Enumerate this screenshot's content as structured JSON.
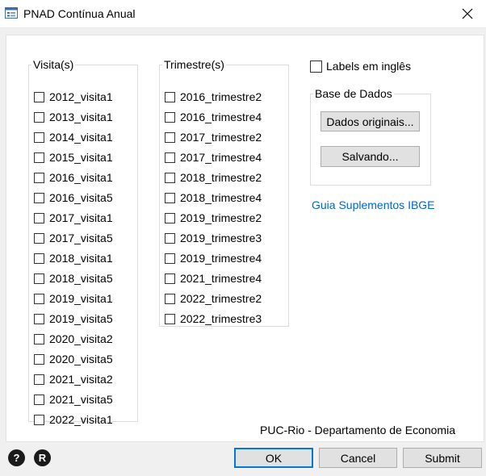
{
  "window": {
    "title": "PNAD Contínua Anual",
    "app_icon": "form-window-icon",
    "close_icon": "close-icon"
  },
  "visitas": {
    "legend": "Visita(s)",
    "items": [
      {
        "label": "2012_visita1",
        "checked": false
      },
      {
        "label": "2013_visita1",
        "checked": false
      },
      {
        "label": "2014_visita1",
        "checked": false
      },
      {
        "label": "2015_visita1",
        "checked": false
      },
      {
        "label": "2016_visita1",
        "checked": false
      },
      {
        "label": "2016_visita5",
        "checked": false
      },
      {
        "label": "2017_visita1",
        "checked": false
      },
      {
        "label": "2017_visita5",
        "checked": false
      },
      {
        "label": "2018_visita1",
        "checked": false
      },
      {
        "label": "2018_visita5",
        "checked": false
      },
      {
        "label": "2019_visita1",
        "checked": false
      },
      {
        "label": "2019_visita5",
        "checked": false
      },
      {
        "label": "2020_visita2",
        "checked": false
      },
      {
        "label": "2020_visita5",
        "checked": false
      },
      {
        "label": "2021_visita2",
        "checked": false
      },
      {
        "label": "2021_visita5",
        "checked": false
      },
      {
        "label": "2022_visita1",
        "checked": false
      }
    ]
  },
  "trimestres": {
    "legend": "Trimestre(s)",
    "items": [
      {
        "label": "2016_trimestre2",
        "checked": false
      },
      {
        "label": "2016_trimestre4",
        "checked": false
      },
      {
        "label": "2017_trimestre2",
        "checked": false
      },
      {
        "label": "2017_trimestre4",
        "checked": false
      },
      {
        "label": "2018_trimestre2",
        "checked": false
      },
      {
        "label": "2018_trimestre4",
        "checked": false
      },
      {
        "label": "2019_trimestre2",
        "checked": false
      },
      {
        "label": "2019_trimestre3",
        "checked": false
      },
      {
        "label": "2019_trimestre4",
        "checked": false
      },
      {
        "label": "2021_trimestre4",
        "checked": false
      },
      {
        "label": "2022_trimestre2",
        "checked": false
      },
      {
        "label": "2022_trimestre3",
        "checked": false
      }
    ]
  },
  "options": {
    "labels_ingles": "Labels em inglês",
    "labels_ingles_checked": false
  },
  "base_dados": {
    "legend": "Base de Dados",
    "dados_originais": "Dados originais...",
    "salvando": "Salvando..."
  },
  "link": "Guia Suplementos IBGE",
  "footer_text": "PUC-Rio - Departamento de Economia",
  "buttons": {
    "ok": "OK",
    "cancel": "Cancel",
    "submit": "Submit",
    "help": "?",
    "reset": "R"
  },
  "colors": {
    "link": "#0066cc",
    "primary_border": "#0078d7"
  }
}
